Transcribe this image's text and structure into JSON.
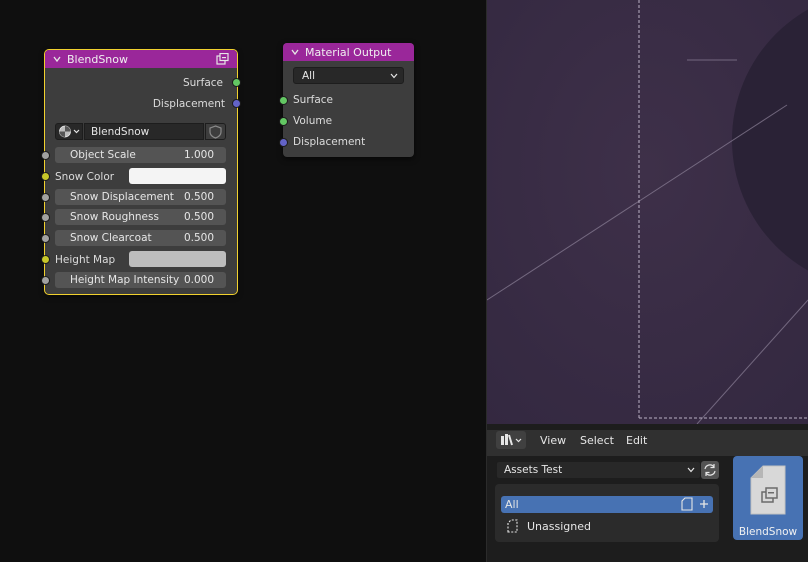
{
  "node_blendsnow": {
    "title": "BlendSnow",
    "outputs": [
      "Surface",
      "Displacement"
    ],
    "datablock_name": "BlendSnow",
    "inputs": [
      {
        "label": "Object Scale",
        "value": "1.000",
        "kind": "number"
      },
      {
        "label": "Snow Color",
        "kind": "color",
        "color": "#f4f4f4"
      },
      {
        "label": "Snow Displacement",
        "value": "0.500",
        "kind": "number"
      },
      {
        "label": "Snow Roughness",
        "value": "0.500",
        "kind": "number"
      },
      {
        "label": "Snow Clearcoat",
        "value": "0.500",
        "kind": "number"
      },
      {
        "label": "Height Map",
        "kind": "color",
        "color": "#bdbdbd"
      },
      {
        "label": "Height Map Intensity",
        "value": "0.000",
        "kind": "number"
      }
    ]
  },
  "node_material_output": {
    "title": "Material Output",
    "target": "All",
    "inputs": [
      "Surface",
      "Volume",
      "Displacement"
    ]
  },
  "asset_browser": {
    "menu": [
      "View",
      "Select",
      "Edit"
    ],
    "library": "Assets Test",
    "catalogs": [
      {
        "label": "All",
        "selected": true
      },
      {
        "label": "Unassigned",
        "selected": false
      }
    ],
    "assets": [
      {
        "name": "BlendSnow"
      }
    ]
  },
  "colors": {
    "node_header": "#9a279a",
    "selection_outline": "#f1d12e",
    "viewport_bg": "#3b2e47",
    "catalog_selected": "#4772b3"
  }
}
